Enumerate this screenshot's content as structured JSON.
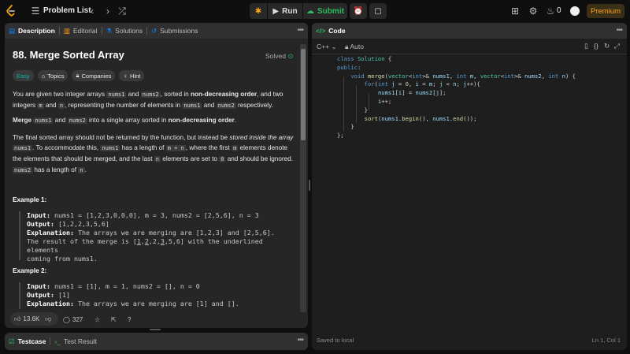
{
  "topbar": {
    "problem_list": "Problem List",
    "run": "Run",
    "submit": "Submit",
    "streak": "0",
    "premium": "Premium"
  },
  "left_tabs": [
    "Description",
    "Editorial",
    "Solutions",
    "Submissions"
  ],
  "problem": {
    "title": "88. Merge Sorted Array",
    "status": "Solved",
    "tags": [
      "Easy",
      "Topics",
      "Companies",
      "Hint"
    ]
  },
  "examples": {
    "ex1_label": "Example 1:",
    "ex1_input": "nums1 = [1,2,3,0,0,0], m = 3, nums2 = [2,5,6], n = 3",
    "ex1_output": "[1,2,2,3,5,6]",
    "ex1_explanation": "The arrays we are merging are [1,2,3] and [2,5,6].",
    "ex1_explanation2": "coming from nums1.",
    "ex2_label": "Example 2:",
    "ex2_input": "nums1 = [1], m = 1, nums2 = [], n = 0",
    "ex2_output": "[1]",
    "ex2_explanation": "The arrays we are merging are [1] and []."
  },
  "stats": {
    "likes": "13.6K",
    "comments": "327"
  },
  "code_panel": {
    "title": "Code",
    "language": "C++",
    "mode": "Auto"
  },
  "code_lines": [
    "class Solution {",
    "public:",
    "    void merge(vector<int>& nums1, int m, vector<int>& nums2, int n) {",
    "        for(int j = 0, i = m; j < n; j++){",
    "            nums1[i] = nums2[j];",
    "            i++;",
    "        }",
    "        sort(nums1.begin(), nums1.end());",
    "    }",
    "};"
  ],
  "bottom": {
    "testcase": "Testcase",
    "test_result": "Test Result",
    "saved": "Saved to local",
    "cursor": "Ln 1, Col 1"
  },
  "colors": {
    "accent": "#ffa116",
    "submit": "#2cbb5d",
    "easy": "#00b8a3",
    "bg": "#0f0f0f",
    "panel": "#262626"
  }
}
